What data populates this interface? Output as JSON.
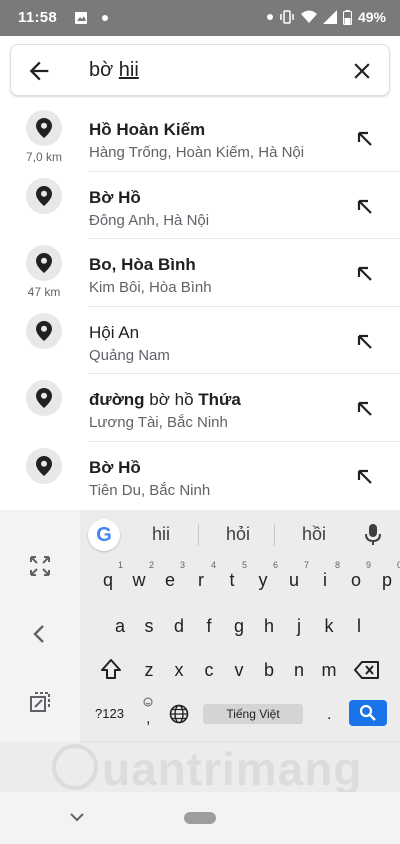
{
  "status_bar": {
    "time": "11:58",
    "battery": "49%",
    "left_icons": [
      "image-icon",
      "dot-icon"
    ],
    "right_icons": [
      "dot-icon",
      "vibrate-icon",
      "wifi-icon",
      "signal-icon",
      "battery-icon"
    ]
  },
  "search": {
    "query_prefix": "bờ ",
    "query_underlined": "hii"
  },
  "results": [
    {
      "title_bold": "Hồ Hoàn Kiếm",
      "title_plain": "",
      "subtitle": "Hàng Trống, Hoàn Kiếm, Hà Nội",
      "distance": "7,0 km"
    },
    {
      "title_bold": "Bờ Hồ",
      "title_plain": "",
      "subtitle": "Đông Anh, Hà Nội",
      "distance": ""
    },
    {
      "title_bold": "Bo, Hòa Bình",
      "title_plain": "",
      "subtitle": "Kim Bôi, Hòa Bình",
      "distance": "47 km"
    },
    {
      "title_bold": "Hội An",
      "title_plain": "",
      "subtitle": "Quảng Nam",
      "distance": ""
    },
    {
      "title_bold": "đường",
      "title_plain": " bờ hồ ",
      "title_bold2": "Thứa",
      "subtitle": "Lương Tài, Bắc Ninh",
      "distance": ""
    },
    {
      "title_bold": "Bờ Hồ",
      "title_plain": "",
      "subtitle": "Tiên Du, Bắc Ninh",
      "distance": ""
    }
  ],
  "keyboard": {
    "google_logo": "G",
    "suggestions": [
      "hii",
      "hỏi",
      "hồi"
    ],
    "row1": [
      [
        "q",
        "1"
      ],
      [
        "w",
        "2"
      ],
      [
        "e",
        "3"
      ],
      [
        "r",
        "4"
      ],
      [
        "t",
        "5"
      ],
      [
        "y",
        "6"
      ],
      [
        "u",
        "7"
      ],
      [
        "i",
        "8"
      ],
      [
        "o",
        "9"
      ],
      [
        "p",
        "0"
      ]
    ],
    "row2": [
      "a",
      "s",
      "d",
      "f",
      "g",
      "h",
      "j",
      "k",
      "l"
    ],
    "row3": [
      "z",
      "x",
      "c",
      "v",
      "b",
      "n",
      "m"
    ],
    "symbols_key": "?123",
    "comma": ",",
    "period": ".",
    "space_label": "Tiếng Việt"
  },
  "watermark": {
    "text": "uantrimang"
  },
  "colors": {
    "accent": "#1a73e8",
    "status_bar": "#7a7a7a",
    "keyboard_bg": "#ececec"
  }
}
